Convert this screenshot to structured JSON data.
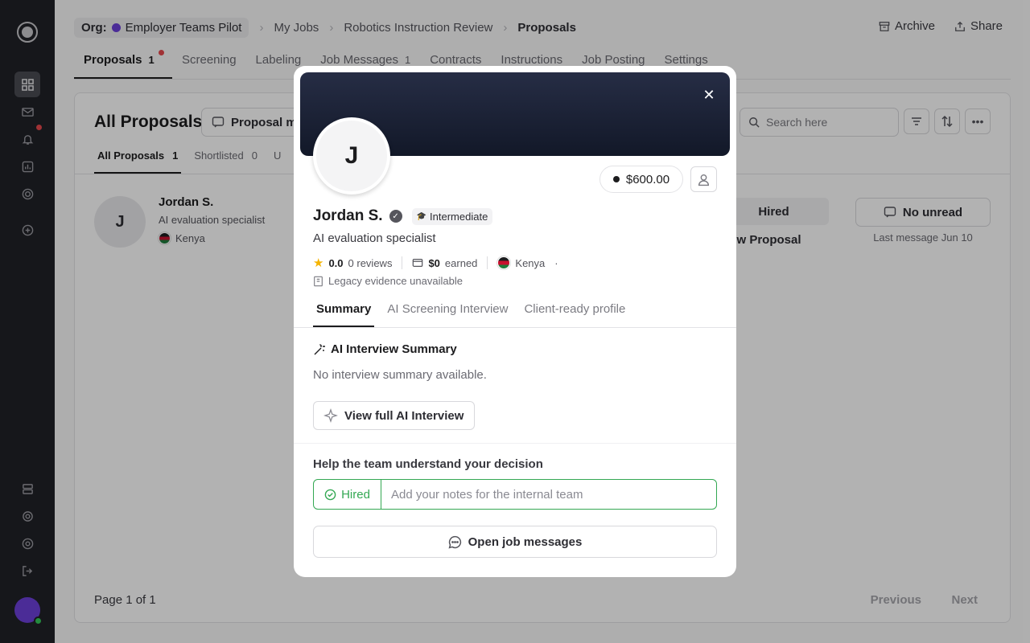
{
  "sidebar": {
    "icons": [
      "logo-icon",
      "dashboard-icon",
      "mail-icon",
      "bell-icon",
      "chart-icon",
      "target-icon",
      "plus-circle-icon",
      "database-icon",
      "gear-icon",
      "help-icon",
      "logout-icon"
    ]
  },
  "breadcrumb": {
    "org_label": "Org:",
    "org_name": "Employer Teams Pilot",
    "items": [
      "My Jobs",
      "Robotics Instruction Review",
      "Proposals"
    ]
  },
  "top_actions": {
    "archive": "Archive",
    "share": "Share"
  },
  "tabs": [
    {
      "label": "Proposals",
      "count": "1"
    },
    {
      "label": "Screening"
    },
    {
      "label": "Labeling"
    },
    {
      "label": "Job Messages",
      "count": "1"
    },
    {
      "label": "Contracts"
    },
    {
      "label": "Instructions"
    },
    {
      "label": "Job Posting"
    },
    {
      "label": "Settings"
    }
  ],
  "panel": {
    "title": "All Proposals",
    "proposal_button": "Proposal m",
    "search_placeholder": "Search here",
    "subtabs": [
      {
        "label": "All Proposals",
        "count": "1"
      },
      {
        "label": "Shortlisted",
        "count": "0"
      },
      {
        "label": "U"
      }
    ],
    "row": {
      "initial": "J",
      "name": "Jordan S.",
      "role": "AI evaluation specialist",
      "country": "Kenya",
      "status": "Hired",
      "view_link": "iew Proposal",
      "unread": "No unread",
      "last_message": "Last message Jun 10"
    },
    "pager": {
      "info": "Page 1 of 1",
      "previous": "Previous",
      "next": "Next"
    }
  },
  "modal": {
    "initial": "J",
    "rate": "$600.00",
    "name": "Jordan S.",
    "level": "Intermediate",
    "role": "AI evaluation specialist",
    "rating": "0.0",
    "reviews": "0 reviews",
    "earned_amount": "$0",
    "earned_label": "earned",
    "country": "Kenya",
    "stats_trailing": "·",
    "evidence": "Legacy evidence unavailable",
    "tabs": [
      "Summary",
      "AI Screening Interview",
      "Client-ready profile"
    ],
    "summary_title": "AI Interview Summary",
    "summary_text": "No interview summary available.",
    "view_ai_button": "View full AI Interview",
    "help_title": "Help the team understand your decision",
    "decision_status": "Hired",
    "notes_placeholder": "Add your notes for the internal team",
    "open_messages": "Open job messages"
  },
  "colors": {
    "sidebar_bg": "#202127",
    "accent_purple": "#6c3fd8",
    "hired_green": "#34a853",
    "banner_dark": "#121828",
    "notification_red": "#e5484d"
  }
}
